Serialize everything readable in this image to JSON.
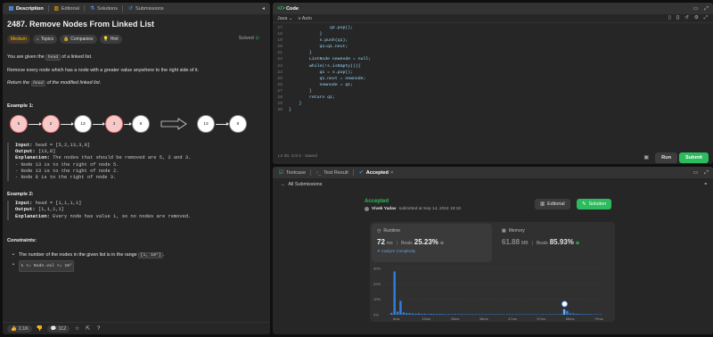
{
  "left": {
    "tabs": [
      {
        "label": "Description",
        "icon": "document-icon"
      },
      {
        "label": "Editorial",
        "icon": "book-icon"
      },
      {
        "label": "Solutions",
        "icon": "flask-icon"
      },
      {
        "label": "Submissions",
        "icon": "history-icon"
      }
    ],
    "title": "2487. Remove Nodes From Linked List",
    "solved": "Solved",
    "tags": [
      "Medium",
      "Topics",
      "Companies",
      "Hint"
    ],
    "desc1_a": "You are given the ",
    "desc1_code": "head",
    "desc1_b": " of a linked list.",
    "desc2": "Remove every node which has a node with a greater value anywhere to the right side of it.",
    "desc3_a": "Return the ",
    "desc3_code": "head",
    "desc3_b": " of the modified linked list.",
    "example1_title": "Example 1:",
    "diagram_before": [
      "5",
      "2",
      "13",
      "3",
      "8"
    ],
    "diagram_after": [
      "13",
      "8"
    ],
    "ex1": {
      "input_label": "Input:",
      "input": " head = [5,2,13,3,8]",
      "output_label": "Output:",
      "output": " [13,8]",
      "explanation_label": "Explanation:",
      "explanation": " The nodes that should be removed are 5, 2 and 3.",
      "lines": [
        "- Node 13 is to the right of node 5.",
        "- Node 13 is to the right of node 2.",
        "- Node 8 is to the right of node 3."
      ]
    },
    "example2_title": "Example 2:",
    "ex2": {
      "input_label": "Input:",
      "input": " head = [1,1,1,1]",
      "output_label": "Output:",
      "output": " [1,1,1,1]",
      "explanation_label": "Explanation:",
      "explanation": " Every node has value 1, so no nodes are removed."
    },
    "constraints_title": "Constraints:",
    "constraint1_a": "The number of the nodes in the given list is in the range ",
    "constraint1_code": "[1, 10⁵]",
    "constraint1_b": ".",
    "constraint2_code": "1 <= Node.val <= 10⁵",
    "footer": {
      "likes": "2.1K",
      "comments": "112"
    }
  },
  "code": {
    "header": "Code",
    "language": "Java",
    "mode": "Auto",
    "lines": [
      {
        "n": "17",
        "t": "                q2.pop();"
      },
      {
        "n": "18",
        "t": "            }"
      },
      {
        "n": "19",
        "t": "            s.push(q1);"
      },
      {
        "n": "20",
        "t": "            q1=q1.next;"
      },
      {
        "n": "21",
        "t": "        }"
      },
      {
        "n": "22",
        "t": "        ListNode newnode = null;"
      },
      {
        "n": "23",
        "t": "        while(!s.isEmpty()){"
      },
      {
        "n": "24",
        "t": "            q1 = s.pop();"
      },
      {
        "n": "25",
        "t": "            q1.next = newnode;"
      },
      {
        "n": "26",
        "t": "            newnode = q1;"
      },
      {
        "n": "27",
        "t": "        }"
      },
      {
        "n": "28",
        "t": "        return q1;"
      },
      {
        "n": "29",
        "t": "    }"
      },
      {
        "n": "30",
        "t": "}"
      }
    ],
    "status": "Ln 30, Col 2  ·  Saved",
    "run": "Run",
    "submit": "Submit"
  },
  "result": {
    "tabs": [
      {
        "label": "Testcase",
        "icon": "check-square-icon"
      },
      {
        "label": "Test Result",
        "icon": "terminal-icon"
      },
      {
        "label": "Accepted",
        "icon": "code-icon"
      }
    ],
    "back": "All Submissions",
    "accepted": "Accepted",
    "user": "Vivek Yadav",
    "submitted": "submitted at Sep 14, 2024 19:18",
    "editorial": "Editorial",
    "solution": "Solution",
    "runtime_label": "Runtime",
    "runtime_value": "72",
    "runtime_unit": "ms",
    "beats_label": "Beats",
    "runtime_beats": "25.23%",
    "analyze": "Analyze Complexity",
    "memory_label": "Memory",
    "memory_value": "61.88",
    "memory_unit": "MB",
    "memory_beats": "85.93%"
  },
  "chart_data": {
    "type": "bar",
    "x_ticks": [
      "6ms",
      "15ms",
      "25ms",
      "36ms",
      "47ms",
      "57ms",
      "68ms",
      "79ms"
    ],
    "y_ticks": [
      "30%",
      "20%",
      "10%",
      "0%"
    ],
    "ylim": [
      0,
      30
    ],
    "values": [
      1.2,
      28,
      2,
      9,
      1.5,
      1,
      1,
      0.8,
      0.6,
      0.8,
      0.5,
      0.6,
      0.4,
      0.6,
      0.5,
      0.4,
      0.5,
      0.4,
      0.3,
      0.4,
      0.3,
      0.4,
      0.3,
      0.4,
      0.3,
      0.3,
      0.3,
      0.3,
      0.3,
      0.3,
      0.3,
      0.3,
      0.3,
      0.3,
      0.3,
      0.3,
      0.3,
      0.3,
      0.3,
      0.3,
      0.3,
      0.3,
      0.3,
      0.3,
      0.3,
      0.3,
      0.3,
      0.3,
      0.3,
      0.3,
      0.3,
      0.3,
      0.3,
      0.3,
      0.3,
      0.3,
      0.4,
      3.5,
      2.5,
      1,
      0.8,
      0.6,
      0.5,
      0.4,
      0.4,
      0.4,
      0.3,
      0.3,
      0.3,
      0.3
    ],
    "highlight_index": 57,
    "color": "#2f7dde",
    "highlight_color": "#6fa8ff"
  }
}
